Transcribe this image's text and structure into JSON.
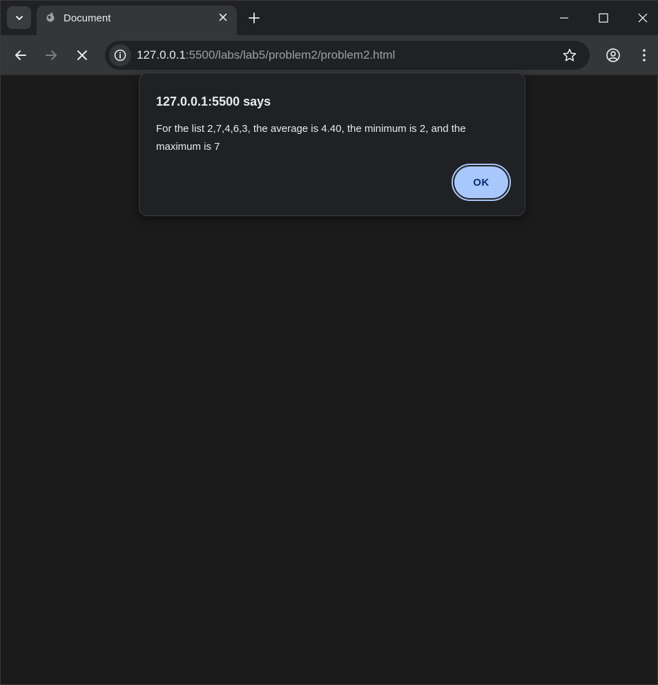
{
  "browser": {
    "tab": {
      "title": "Document"
    },
    "address_bar": {
      "host": "127.0.0.1",
      "rest": ":5500/labs/lab5/problem2/problem2.html"
    }
  },
  "dialog": {
    "title": "127.0.0.1:5500 says",
    "message": "For the list 2,7,4,6,3, the average is 4.40, the minimum is 2, and the maximum is 7",
    "ok_label": "OK"
  },
  "colors": {
    "page_background": "#1b1b1b",
    "tabstrip": "#202124",
    "toolbar": "#35363a",
    "button_accent": "#a8c7fa"
  },
  "icons": [
    "chevron-down-icon",
    "globe-icon",
    "close-icon",
    "plus-icon",
    "minimize-icon",
    "maximize-icon",
    "back-icon",
    "forward-icon",
    "stop-icon",
    "info-icon",
    "star-icon",
    "profile-icon",
    "menu-icon"
  ]
}
